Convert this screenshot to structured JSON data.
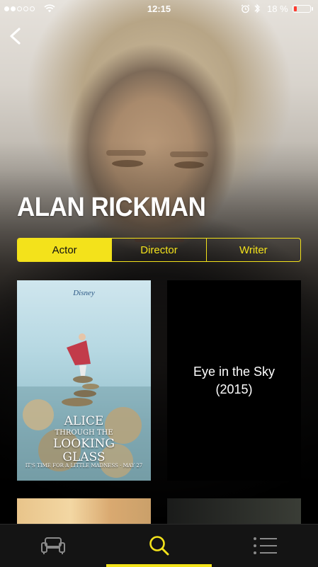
{
  "status_bar": {
    "time": "12:15",
    "battery_percent": "18 %",
    "battery_level": 0.18,
    "signal_bars_filled": 2,
    "signal_bars_total": 5
  },
  "person": {
    "name": "ALAN RICKMAN"
  },
  "roles": {
    "tabs": [
      {
        "label": "Actor",
        "active": true
      },
      {
        "label": "Director",
        "active": false
      },
      {
        "label": "Writer",
        "active": false
      }
    ]
  },
  "filmography": [
    {
      "type": "poster",
      "studio": "Disney",
      "title_lines": [
        "ALICE",
        "THROUGH THE",
        "LOOKING",
        "GLASS"
      ],
      "tagline": "IT'S TIME FOR A LITTLE MADNESS · MAY 27"
    },
    {
      "type": "text",
      "title": "Eye in the Sky",
      "year": "(2015)"
    },
    {
      "type": "poster"
    },
    {
      "type": "poster"
    }
  ],
  "tab_bar": {
    "tabs": [
      {
        "icon": "couch-icon",
        "active": false
      },
      {
        "icon": "search-icon",
        "active": true
      },
      {
        "icon": "list-icon",
        "active": false
      }
    ]
  },
  "colors": {
    "accent": "#f3e21b",
    "background": "#000000",
    "battery_low": "#ff3b30"
  }
}
